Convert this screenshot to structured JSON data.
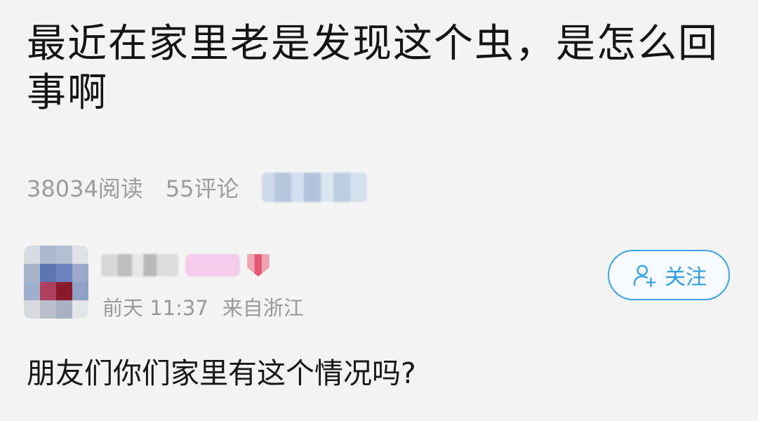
{
  "post": {
    "title": "最近在家里老是发现这个虫，是怎么回事啊",
    "reads": "38034阅读",
    "comments": "55评论",
    "body": "朋友们你们家里有这个情况吗?"
  },
  "author": {
    "time": "前天 11:37",
    "location": "来自浙江"
  },
  "follow": {
    "label": "关注",
    "icon": "add-user-icon"
  },
  "colors": {
    "accent": "#3aa5e4",
    "background": "#f4f4f4",
    "meta_text": "#9c9c9c"
  }
}
